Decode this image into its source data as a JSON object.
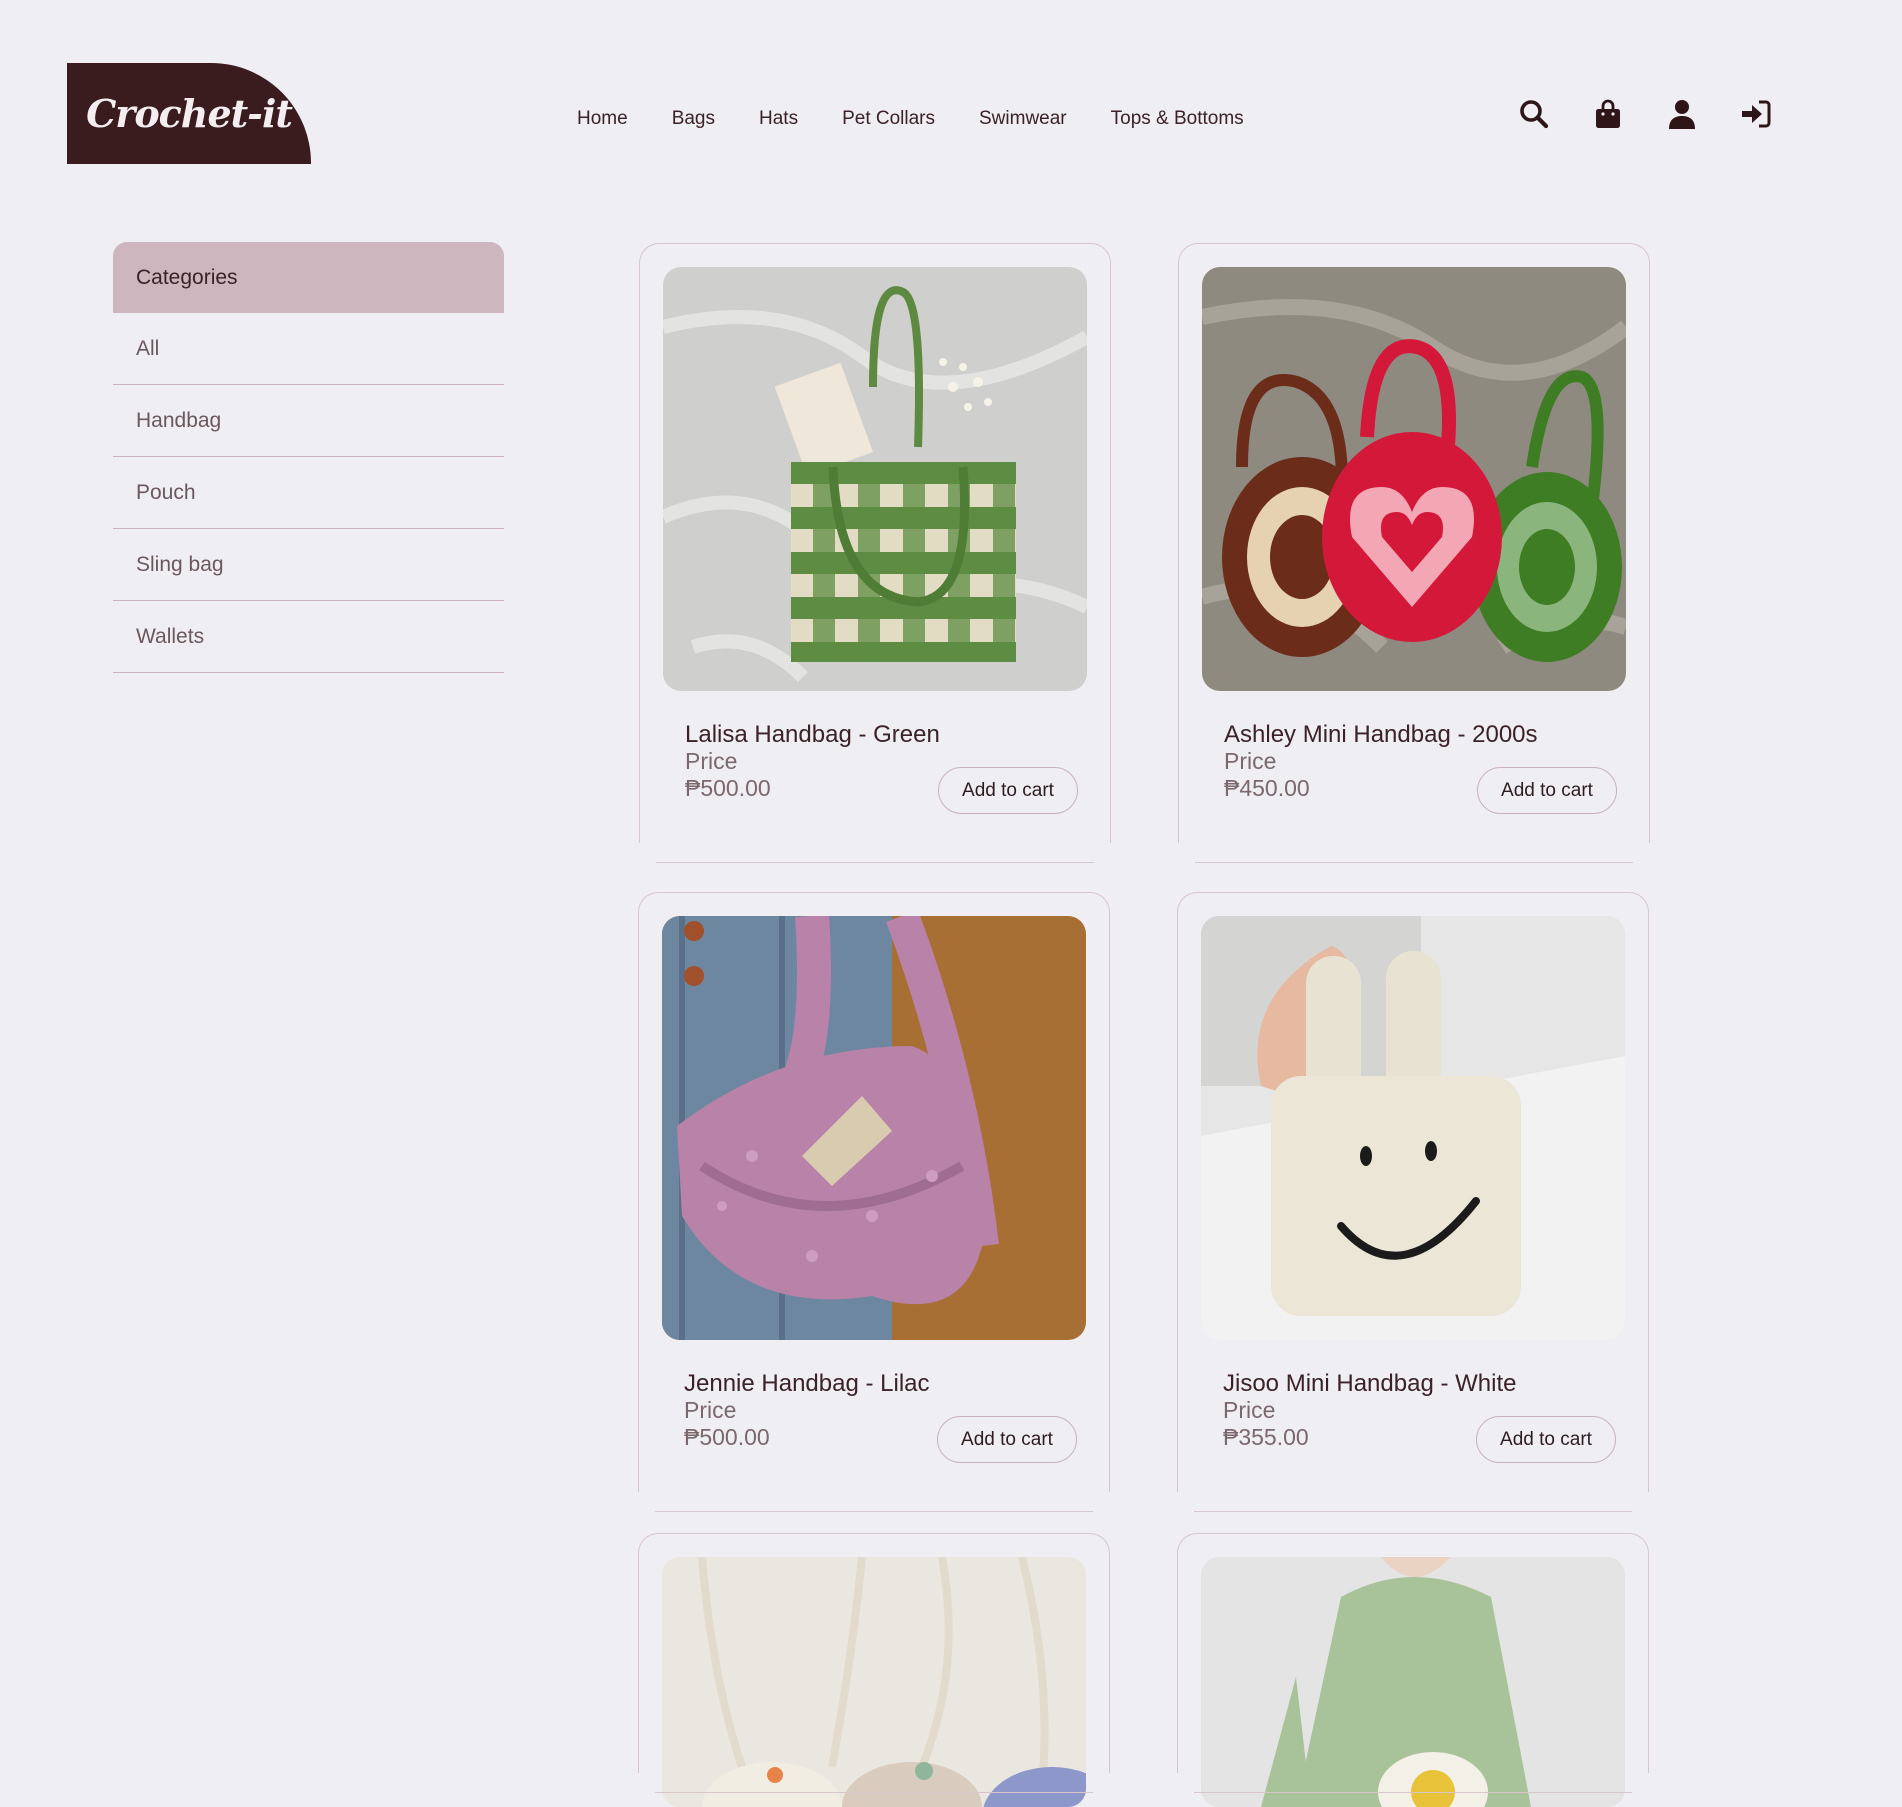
{
  "brand": {
    "logo_text": "Crochet-it",
    "logo_color": "#3a1c1f"
  },
  "nav": {
    "items": [
      "Home",
      "Bags",
      "Hats",
      "Pet Collars",
      "Swimwear",
      "Tops & Bottoms"
    ]
  },
  "header_icons": [
    "search-icon",
    "shopping-bag-icon",
    "user-icon",
    "sign-in-icon"
  ],
  "sidebar": {
    "title": "Categories",
    "items": [
      "All",
      "Handbag",
      "Pouch",
      "Sling bag",
      "Wallets"
    ]
  },
  "products": [
    {
      "name": "Lalisa Handbag - Green",
      "price_label": "Price",
      "price": "₱500.00",
      "button": "Add to cart"
    },
    {
      "name": "Ashley Mini Handbag - 2000s",
      "price_label": "Price",
      "price": "₱450.00",
      "button": "Add to cart"
    },
    {
      "name": "Jennie Handbag - Lilac",
      "price_label": "Price",
      "price": "₱500.00",
      "button": "Add to cart"
    },
    {
      "name": "Jisoo Mini Handbag - White",
      "price_label": "Price",
      "price": "₱355.00",
      "button": "Add to cart"
    }
  ],
  "colors": {
    "background": "#efeef2",
    "accent": "#cdb6bd",
    "text": "#3a2226"
  }
}
